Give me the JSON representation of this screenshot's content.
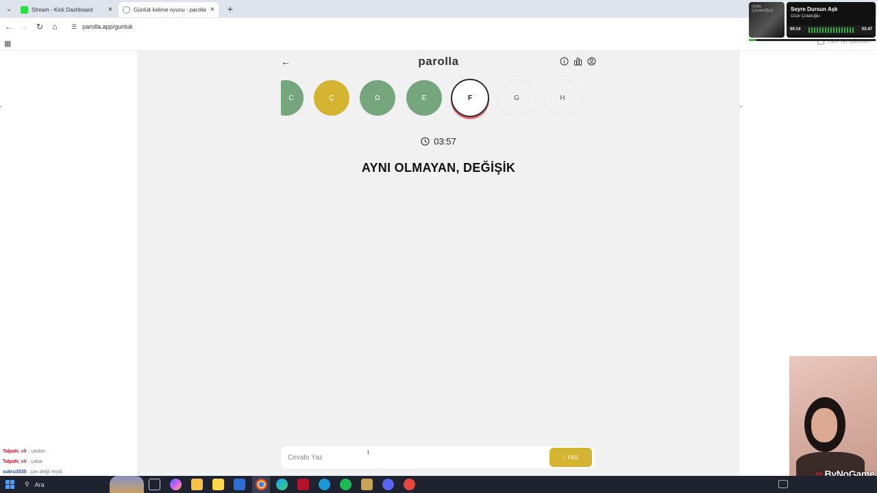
{
  "browser": {
    "tabs": [
      {
        "title": "Stream - Kick Dashboard",
        "favicon_color": "#2ce03c"
      },
      {
        "title": "Günlük kelime oyunu - parolla",
        "favicon_color": "#9aa0a6"
      }
    ],
    "url": "parolla.app/gunluk",
    "all_bookmarks": "Tüm Yer İşaretleri"
  },
  "game": {
    "logo": "parolla",
    "letters": [
      {
        "letter": "C",
        "state": "green"
      },
      {
        "letter": "Ç",
        "state": "yellow"
      },
      {
        "letter": "D",
        "state": "green"
      },
      {
        "letter": "E",
        "state": "green"
      },
      {
        "letter": "F",
        "state": "current"
      },
      {
        "letter": "G",
        "state": "pending"
      },
      {
        "letter": "H",
        "state": "pending"
      }
    ],
    "timer": "03:57",
    "question": "AYNI OLMAYAN, DEĞİŞİK",
    "answer_placeholder": "Cevabı Yaz",
    "pass_label": "PAS",
    "colors": {
      "green": "#76a67e",
      "yellow": "#d4b431",
      "current_ring": "#e06a6a"
    }
  },
  "chat": [
    {
      "user": "TalpaN_vlr",
      "message": "çanker"
    },
    {
      "user": "TalpaN_vlr",
      "message": "çakar"
    },
    {
      "user": "sukru3535",
      "message": "çan değil miydi"
    }
  ],
  "music": {
    "album_label": "OZAN ÇOLAKOĞLU",
    "song": "Seyre Dursun Aşk",
    "artist": "Ozan Çolakoğlu",
    "elapsed": "00:14",
    "total": "03:47",
    "progress": 0.06
  },
  "webcam": {
    "brand": "ByNoGame"
  },
  "taskbar": {
    "search_label": "Ara"
  }
}
